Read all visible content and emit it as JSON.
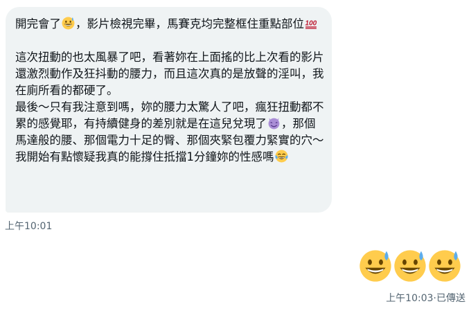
{
  "incoming_message": {
    "paragraph_1": {
      "part_1": "開完會了",
      "emoji_1": "grinning-sweat-emoji",
      "part_2": "，影片檢視完畢，馬賽克均完整框住重點部位",
      "emoji_2": "hundred-points-emoji"
    },
    "paragraph_2": {
      "part_1": "這次扭動的也太風暴了吧，看著妳在上面搖的比上次看的影片還激烈動作及狂抖動的腰力，而且這次真的是放聲的淫叫，我在廁所看的都硬了。\n最後～只有我注意到嗎，妳的腰力太驚人了吧，瘋狂扭動都不累的感覺耶，有持續健身的差別就是在這兒兌現了",
      "emoji_1": "smiling-devil-emoji",
      "part_2": "，那個馬達般的腰、那個電力十足的臀、那個夾緊包覆力緊實的穴～我開始有點懷疑我真的能撐住抵擋1分鐘妳的性感嗎",
      "emoji_2": "tears-of-joy-emoji"
    },
    "timestamp": "上午10:01"
  },
  "outgoing_message": {
    "emojis": [
      "grinning-sweat-emoji",
      "grinning-sweat-emoji",
      "grinning-sweat-emoji"
    ],
    "timestamp": "上午10:03",
    "separator": "·",
    "status": "已傳送"
  },
  "colors": {
    "bubble_background": "#eff3f4",
    "text": "#0f1419",
    "meta_text": "#536471",
    "emoji_yellow": "#ffcc4d",
    "sweat_blue": "#5dadec",
    "hundred_red": "#be1931",
    "devil_purple": "#aa8ed6"
  }
}
